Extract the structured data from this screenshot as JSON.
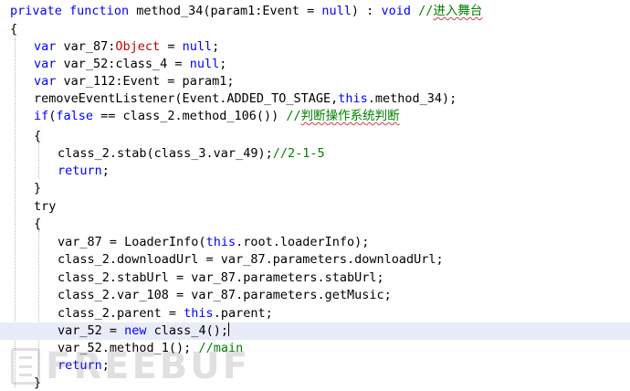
{
  "editor": {
    "watermark": "FREEBUF",
    "colors": {
      "keyword": "#0000ff",
      "type": "#c00000",
      "comment": "#008000",
      "current_line": "#e8ecf8"
    }
  },
  "code": {
    "l01": {
      "k1": "private",
      "s1": " ",
      "k2": "function",
      "s2": " method_34(param1:Event = ",
      "k3": "null",
      "s3": ") : ",
      "k4": "void",
      "s4": " ",
      "c1": "//",
      "c2": "进入舞台"
    },
    "l02": {
      "t": "{"
    },
    "l03": {
      "k1": "var",
      "s1": " var_87:",
      "ty": "Object",
      "s2": " = ",
      "k2": "null",
      "s3": ";"
    },
    "l04": {
      "k1": "var",
      "s1": " var_52:class_4 = ",
      "k2": "null",
      "s2": ";"
    },
    "l05": {
      "k1": "var",
      "s1": " var_112:Event = param1;"
    },
    "l06": {
      "s1": "removeEventListener(Event.ADDED_TO_STAGE,",
      "k1": "this",
      "s2": ".method_34);"
    },
    "l07": {
      "k1": "if",
      "s1": "(",
      "k2": "false",
      "s2": " == class_2.method_106()) ",
      "c1": "//",
      "c2": "判断操作系统判断"
    },
    "l08": {
      "t": "{"
    },
    "l09": {
      "s1": "class_2.stab(class_3.var_49);",
      "c1": "//2-1-5"
    },
    "l10": {
      "k1": "return",
      "s1": ";"
    },
    "l11": {
      "t": "}"
    },
    "l12": {
      "t": "try"
    },
    "l13": {
      "t": "{"
    },
    "l14": {
      "s1": "var_87 = LoaderInfo(",
      "k1": "this",
      "s2": ".root.loaderInfo);"
    },
    "l15": {
      "t": "class_2.downloadUrl = var_87.parameters.downloadUrl;"
    },
    "l16": {
      "t": "class_2.stabUrl = var_87.parameters.stabUrl;"
    },
    "l17": {
      "t": "class_2.var_108 = var_87.parameters.getMusic;"
    },
    "l18": {
      "s1": "class_2.parent = ",
      "k1": "this",
      "s2": ".parent;"
    },
    "l19": {
      "s1": "var_52 = ",
      "k1": "new",
      "s2": " class_4();"
    },
    "l20": {
      "s1": "var_52.method_1(); ",
      "c1": "//main"
    },
    "l21": {
      "k1": "return",
      "s1": ";"
    },
    "l22": {
      "t": "}"
    }
  }
}
